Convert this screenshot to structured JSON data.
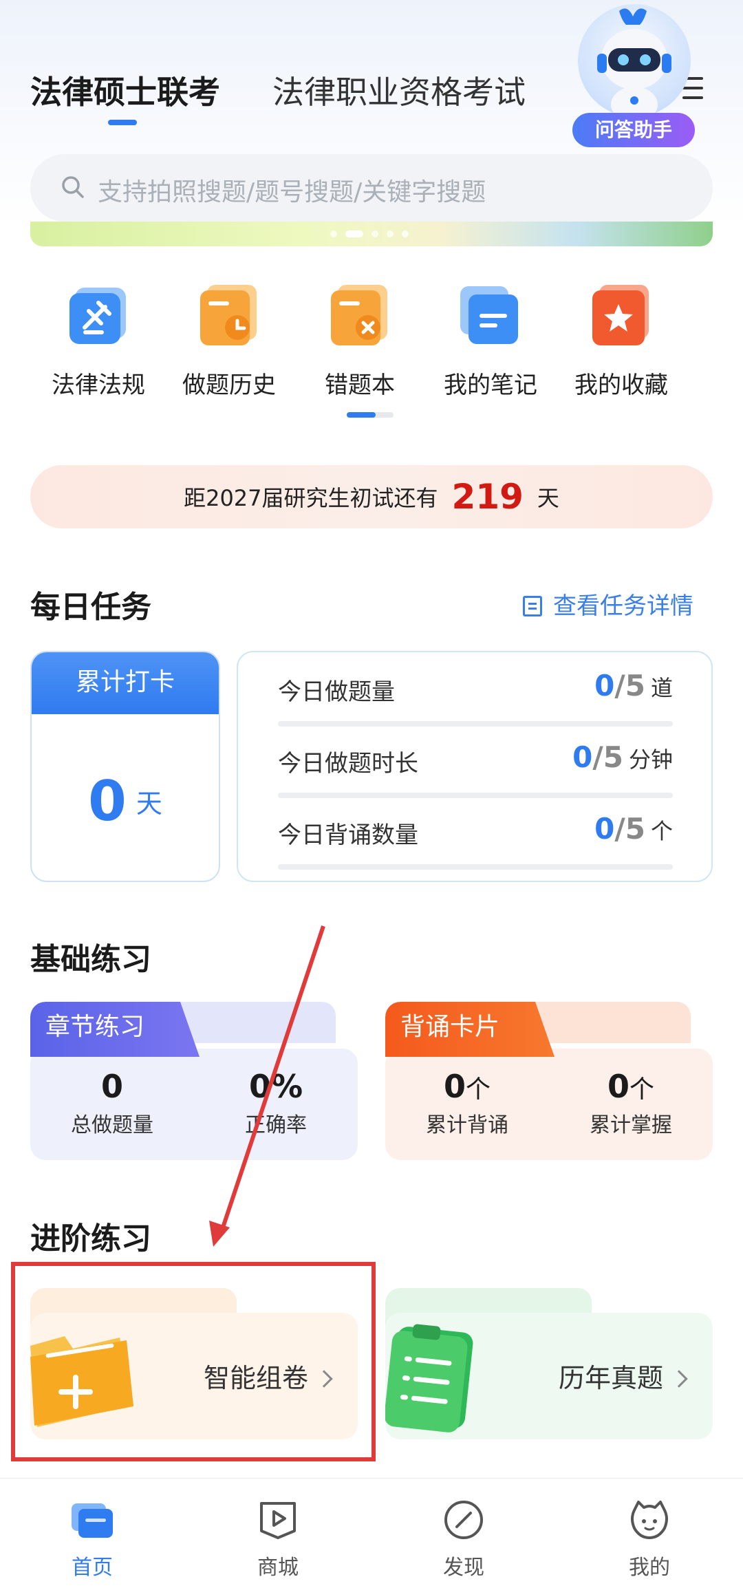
{
  "header": {
    "tabs": [
      {
        "label": "法律硕士联考",
        "active": true
      },
      {
        "label": "法律职业资格考试",
        "active": false
      }
    ],
    "assistant_label": "问答助手"
  },
  "search": {
    "placeholder": "支持拍照搜题/题号搜题/关键字搜题"
  },
  "quick_entries": [
    {
      "label": "法律法规",
      "icon": "law-book-icon",
      "color": "#3d8ef5"
    },
    {
      "label": "做题历史",
      "icon": "history-calendar-icon",
      "color": "#f7a53b"
    },
    {
      "label": "错题本",
      "icon": "wrong-questions-icon",
      "color": "#f7a53b"
    },
    {
      "label": "我的笔记",
      "icon": "note-icon",
      "color": "#3d8ef5"
    },
    {
      "label": "我的收藏",
      "icon": "star-icon",
      "color": "#f05a2e"
    }
  ],
  "countdown": {
    "prefix": "距2027届研究生初试还有",
    "days": "219",
    "unit": "天"
  },
  "daily_task": {
    "title": "每日任务",
    "detail_link": "查看任务详情",
    "checkin": {
      "title": "累计打卡",
      "value": "0",
      "unit": "天"
    },
    "items": [
      {
        "label": "今日做题量",
        "done": "0",
        "total": "/5",
        "unit": "道"
      },
      {
        "label": "今日做题时长",
        "done": "0",
        "total": "/5",
        "unit": "分钟"
      },
      {
        "label": "今日背诵数量",
        "done": "0",
        "total": "/5",
        "unit": "个"
      }
    ]
  },
  "basic_practice": {
    "title": "基础练习",
    "cards": [
      {
        "title": "章节练习",
        "stats": [
          {
            "value": "0",
            "unit": "",
            "label": "总做题量"
          },
          {
            "value": "0%",
            "unit": "",
            "label": "正确率"
          }
        ]
      },
      {
        "title": "背诵卡片",
        "stats": [
          {
            "value": "0",
            "unit": "个",
            "label": "累计背诵"
          },
          {
            "value": "0",
            "unit": "个",
            "label": "累计掌握"
          }
        ]
      }
    ]
  },
  "advanced_practice": {
    "title": "进阶练习",
    "cards": [
      {
        "label": "智能组卷",
        "icon": "folder-add-icon"
      },
      {
        "label": "历年真题",
        "icon": "clipboard-list-icon"
      }
    ]
  },
  "bottom_nav": [
    {
      "label": "首页",
      "active": true
    },
    {
      "label": "商城",
      "active": false
    },
    {
      "label": "发现",
      "active": false
    },
    {
      "label": "我的",
      "active": false
    }
  ],
  "colors": {
    "accent": "#2f7bf0",
    "countdown_red": "#d01a12",
    "annotation_red": "#e03b3b"
  }
}
